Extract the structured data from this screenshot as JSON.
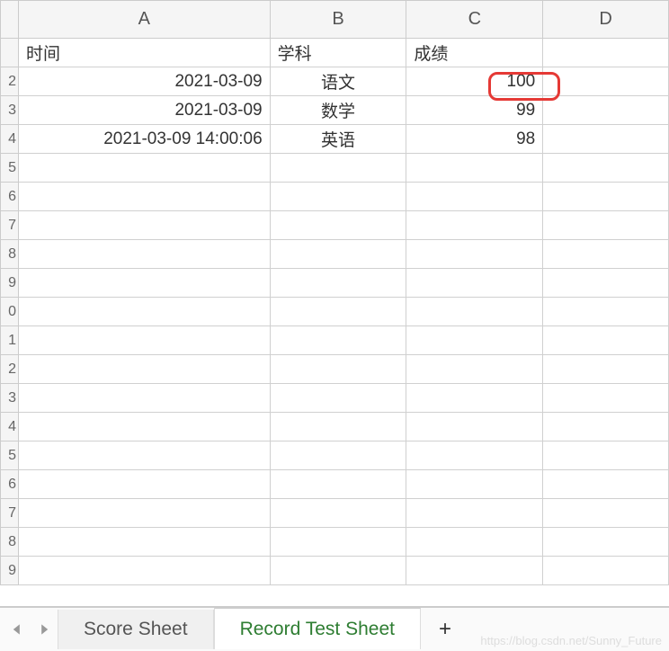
{
  "columns": [
    "A",
    "B",
    "C",
    "D"
  ],
  "row_numbers": [
    "",
    "2",
    "3",
    "4",
    "5",
    "6",
    "7",
    "8",
    "9",
    "0",
    "1",
    "2",
    "3",
    "4",
    "5",
    "6",
    "7",
    "8",
    "9"
  ],
  "headers": {
    "time": "时间",
    "subject": "学科",
    "score": "成绩"
  },
  "rows": [
    {
      "time": "2021-03-09",
      "subject": "语文",
      "score": "100"
    },
    {
      "time": "2021-03-09",
      "subject": "数学",
      "score": "99"
    },
    {
      "time": "2021-03-09 14:00:06",
      "subject": "英语",
      "score": "98"
    }
  ],
  "tabs": {
    "tab1": "Score Sheet",
    "tab2": "Record Test Sheet",
    "add": "+"
  },
  "watermark": "https://blog.csdn.net/Sunny_Future"
}
